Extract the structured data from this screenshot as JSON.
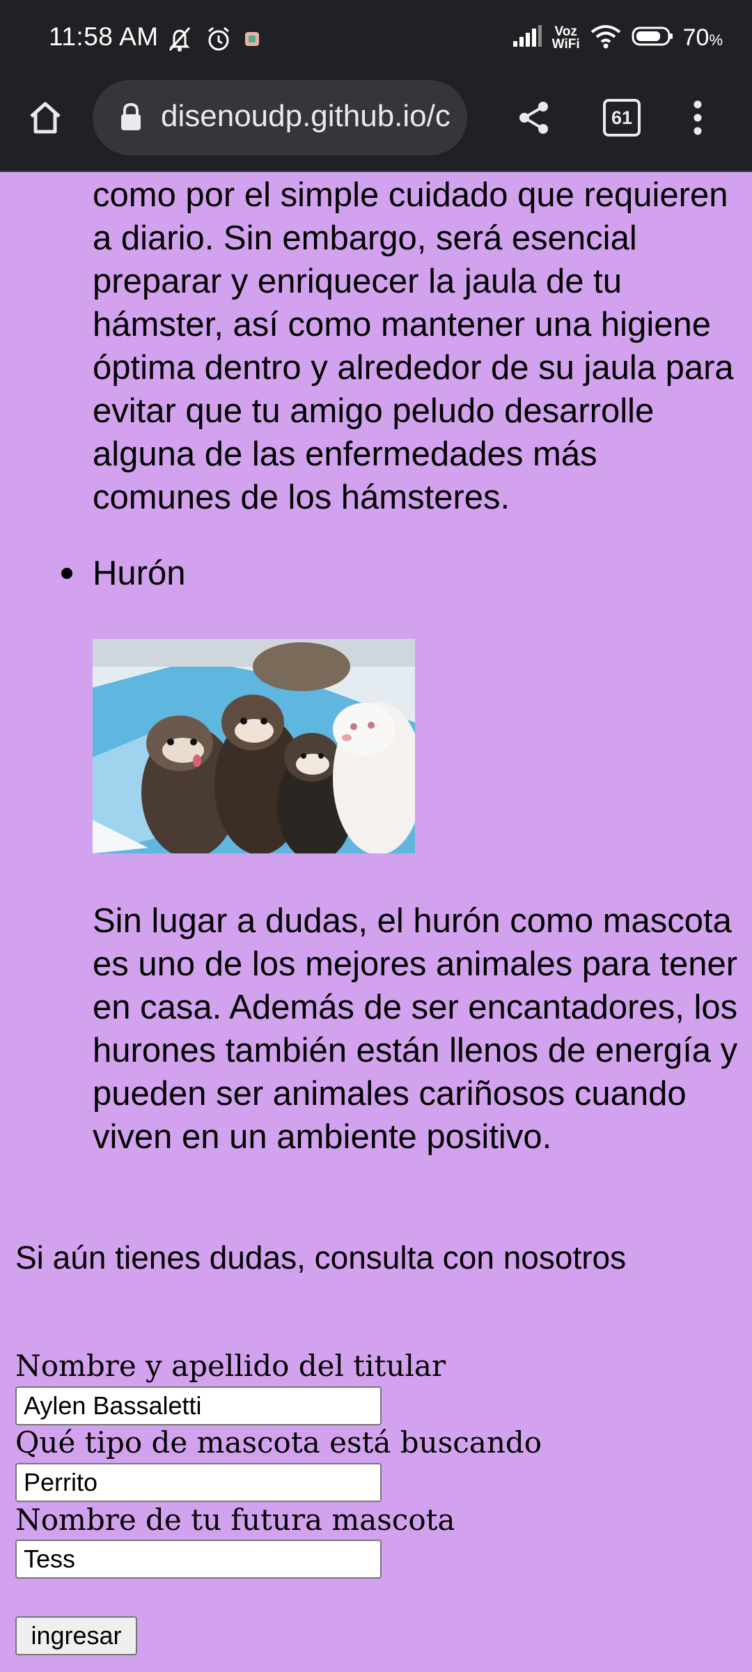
{
  "status_bar": {
    "time": "11:58 AM",
    "icons_left": [
      "mute-icon",
      "alarm-icon",
      "app-notification-icon"
    ],
    "icons_right": [
      "signal-icon",
      "vowifi-icon",
      "wifi-icon",
      "battery-icon"
    ],
    "voz_wifi_top": "Voz",
    "voz_wifi_bottom": "WiFi",
    "battery_value": "70",
    "battery_unit": "%"
  },
  "browser": {
    "url": "disenoudp.github.io/c",
    "tab_count": "61"
  },
  "content": {
    "hamster_paragraph": "como por el simple cuidado que requieren a diario. Sin embargo, será esencial preparar y enriquecer la jaula de tu hámster, así como mantener una higiene óptima dentro y alrededor de su jaula para evitar que tu amigo peludo desarrolle alguna de las enfermedades más comunes de los hámsteres.",
    "ferret_item": "Hurón",
    "ferret_paragraph": "Sin lugar a dudas, el hurón como mascota es uno de los mejores animales para tener en casa. Además de ser encantadores, los hurones también están llenos de energía y pueden ser animales cariñosos cuando viven en un ambiente positivo.",
    "consult_text": "Si aún tienes dudas, consulta con nosotros"
  },
  "form": {
    "owner_label": "Nombre y apellido del titular",
    "owner_value": "Aylen Bassaletti",
    "pet_type_label": "Qué tipo de mascota está buscando",
    "pet_type_value": "Perrito",
    "pet_name_label": "Nombre de tu futura mascota",
    "pet_name_value": "Tess",
    "submit_label": "ingresar"
  },
  "colors": {
    "page_background": "#d3a2ee",
    "browser_chrome": "#202124",
    "url_pill": "#35363a"
  }
}
